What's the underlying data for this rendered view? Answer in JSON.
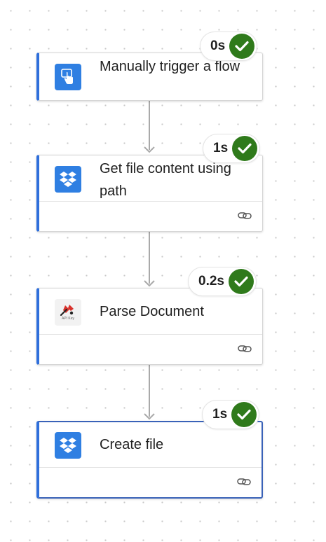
{
  "flow": {
    "steps": [
      {
        "title": "Manually trigger a flow",
        "duration": "0s",
        "status": "succeeded",
        "icon": "hand-tap-icon"
      },
      {
        "title": "Get file content using path",
        "duration": "1s",
        "status": "succeeded",
        "icon": "dropbox-icon"
      },
      {
        "title": "Parse Document",
        "duration": "0.2s",
        "status": "succeeded",
        "icon": "api-key-icon",
        "icon_caption": "API Key"
      },
      {
        "title": "Create file",
        "duration": "1s",
        "status": "succeeded",
        "icon": "dropbox-icon"
      }
    ]
  },
  "colors": {
    "accent_bar": "#2f6fdb",
    "success": "#2f7a1b",
    "connector": "#a9a9a9",
    "connector_icon_bg": "#2f7fe2"
  }
}
